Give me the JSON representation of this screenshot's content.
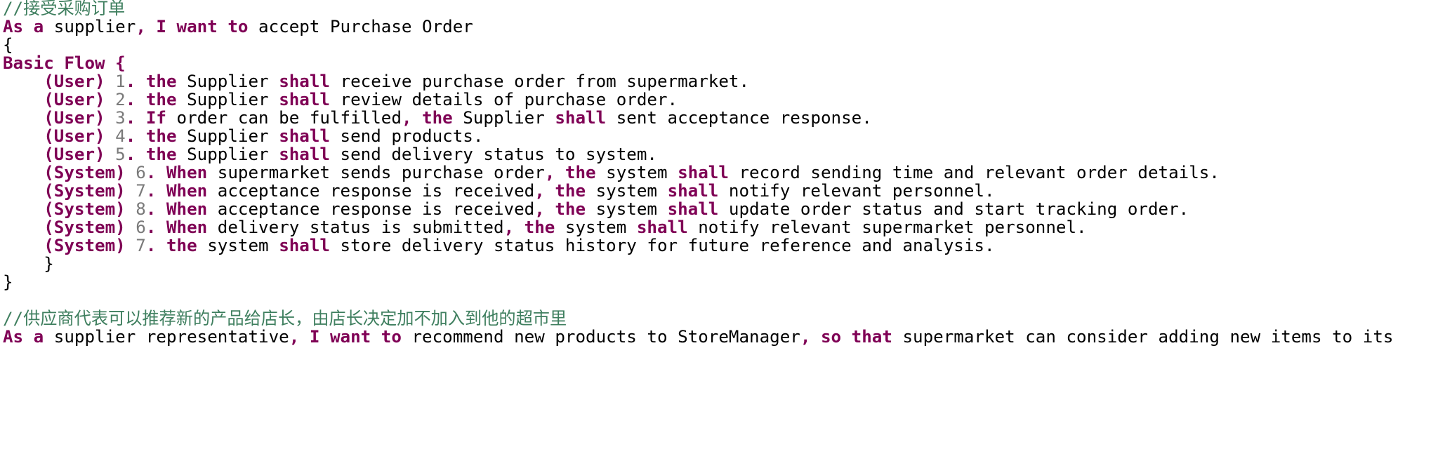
{
  "colors": {
    "background": "#ffffff",
    "text": "#000000",
    "keyword": "#7f0055",
    "comment": "#3f7f5f",
    "number": "#7a7a7a"
  },
  "editor": {
    "lines": [
      {
        "tokens": [
          {
            "t": "//接受采购订单",
            "c": "cmt"
          }
        ]
      },
      {
        "tokens": [
          {
            "t": "As a",
            "c": "kw"
          },
          {
            "t": " supplier",
            "c": "plain"
          },
          {
            "t": ", I want to",
            "c": "kw"
          },
          {
            "t": " accept Purchase Order",
            "c": "plain"
          }
        ]
      },
      {
        "tokens": [
          {
            "t": "{",
            "c": "plain"
          }
        ]
      },
      {
        "tokens": [
          {
            "t": "Basic Flow {",
            "c": "kw"
          }
        ]
      },
      {
        "tokens": [
          {
            "t": "    (User)",
            "c": "kw"
          },
          {
            "t": " 1",
            "c": "num"
          },
          {
            "t": ". the",
            "c": "kw"
          },
          {
            "t": " Supplier ",
            "c": "plain"
          },
          {
            "t": "shall",
            "c": "kw"
          },
          {
            "t": " receive purchase order from supermarket.",
            "c": "plain"
          }
        ]
      },
      {
        "tokens": [
          {
            "t": "    (User)",
            "c": "kw"
          },
          {
            "t": " 2",
            "c": "num"
          },
          {
            "t": ". the",
            "c": "kw"
          },
          {
            "t": " Supplier ",
            "c": "plain"
          },
          {
            "t": "shall",
            "c": "kw"
          },
          {
            "t": " review details of purchase order.",
            "c": "plain"
          }
        ]
      },
      {
        "tokens": [
          {
            "t": "    (User)",
            "c": "kw"
          },
          {
            "t": " 3",
            "c": "num"
          },
          {
            "t": ". If",
            "c": "kw"
          },
          {
            "t": " order can be fulfilled",
            "c": "plain"
          },
          {
            "t": ", the",
            "c": "kw"
          },
          {
            "t": " Supplier ",
            "c": "plain"
          },
          {
            "t": "shall",
            "c": "kw"
          },
          {
            "t": " sent acceptance response.",
            "c": "plain"
          }
        ]
      },
      {
        "tokens": [
          {
            "t": "    (User)",
            "c": "kw"
          },
          {
            "t": " 4",
            "c": "num"
          },
          {
            "t": ". the",
            "c": "kw"
          },
          {
            "t": " Supplier ",
            "c": "plain"
          },
          {
            "t": "shall",
            "c": "kw"
          },
          {
            "t": " send products.",
            "c": "plain"
          }
        ]
      },
      {
        "tokens": [
          {
            "t": "    (User)",
            "c": "kw"
          },
          {
            "t": " 5",
            "c": "num"
          },
          {
            "t": ". the",
            "c": "kw"
          },
          {
            "t": " Supplier ",
            "c": "plain"
          },
          {
            "t": "shall",
            "c": "kw"
          },
          {
            "t": " send delivery status to system.",
            "c": "plain"
          }
        ]
      },
      {
        "tokens": [
          {
            "t": "    (System)",
            "c": "kw"
          },
          {
            "t": " 6",
            "c": "num"
          },
          {
            "t": ". When",
            "c": "kw"
          },
          {
            "t": " supermarket sends purchase order",
            "c": "plain"
          },
          {
            "t": ", the",
            "c": "kw"
          },
          {
            "t": " system ",
            "c": "plain"
          },
          {
            "t": "shall",
            "c": "kw"
          },
          {
            "t": " record sending time and relevant order details.",
            "c": "plain"
          }
        ]
      },
      {
        "tokens": [
          {
            "t": "    (System)",
            "c": "kw"
          },
          {
            "t": " 7",
            "c": "num"
          },
          {
            "t": ". When",
            "c": "kw"
          },
          {
            "t": " acceptance response is received",
            "c": "plain"
          },
          {
            "t": ", the",
            "c": "kw"
          },
          {
            "t": " system ",
            "c": "plain"
          },
          {
            "t": "shall",
            "c": "kw"
          },
          {
            "t": " notify relevant personnel.",
            "c": "plain"
          }
        ]
      },
      {
        "tokens": [
          {
            "t": "    (System)",
            "c": "kw"
          },
          {
            "t": " 8",
            "c": "num"
          },
          {
            "t": ". When",
            "c": "kw"
          },
          {
            "t": " acceptance response is received",
            "c": "plain"
          },
          {
            "t": ", the",
            "c": "kw"
          },
          {
            "t": " system ",
            "c": "plain"
          },
          {
            "t": "shall",
            "c": "kw"
          },
          {
            "t": " update order status and start tracking order.",
            "c": "plain"
          }
        ]
      },
      {
        "tokens": [
          {
            "t": "    (System)",
            "c": "kw"
          },
          {
            "t": " 6",
            "c": "num"
          },
          {
            "t": ". When",
            "c": "kw"
          },
          {
            "t": " delivery status is submitted",
            "c": "plain"
          },
          {
            "t": ", the",
            "c": "kw"
          },
          {
            "t": " system ",
            "c": "plain"
          },
          {
            "t": "shall",
            "c": "kw"
          },
          {
            "t": " notify relevant supermarket personnel.",
            "c": "plain"
          }
        ]
      },
      {
        "tokens": [
          {
            "t": "    (System)",
            "c": "kw"
          },
          {
            "t": " 7",
            "c": "num"
          },
          {
            "t": ". the",
            "c": "kw"
          },
          {
            "t": " system ",
            "c": "plain"
          },
          {
            "t": "shall",
            "c": "kw"
          },
          {
            "t": " store delivery status history for future reference and analysis.",
            "c": "plain"
          }
        ]
      },
      {
        "tokens": [
          {
            "t": "    }",
            "c": "plain"
          }
        ]
      },
      {
        "tokens": [
          {
            "t": "}",
            "c": "plain"
          }
        ]
      },
      {
        "tokens": []
      },
      {
        "tokens": [
          {
            "t": "//供应商代表可以推荐新的产品给店长，由店长决定加不加入到他的超市里",
            "c": "cmt"
          }
        ]
      },
      {
        "tokens": [
          {
            "t": "As a",
            "c": "kw"
          },
          {
            "t": " supplier representative",
            "c": "plain"
          },
          {
            "t": ", I want to",
            "c": "kw"
          },
          {
            "t": " recommend new products to StoreManager",
            "c": "plain"
          },
          {
            "t": ", so that",
            "c": "kw"
          },
          {
            "t": " supermarket can consider adding new items to its",
            "c": "plain"
          }
        ]
      }
    ]
  }
}
